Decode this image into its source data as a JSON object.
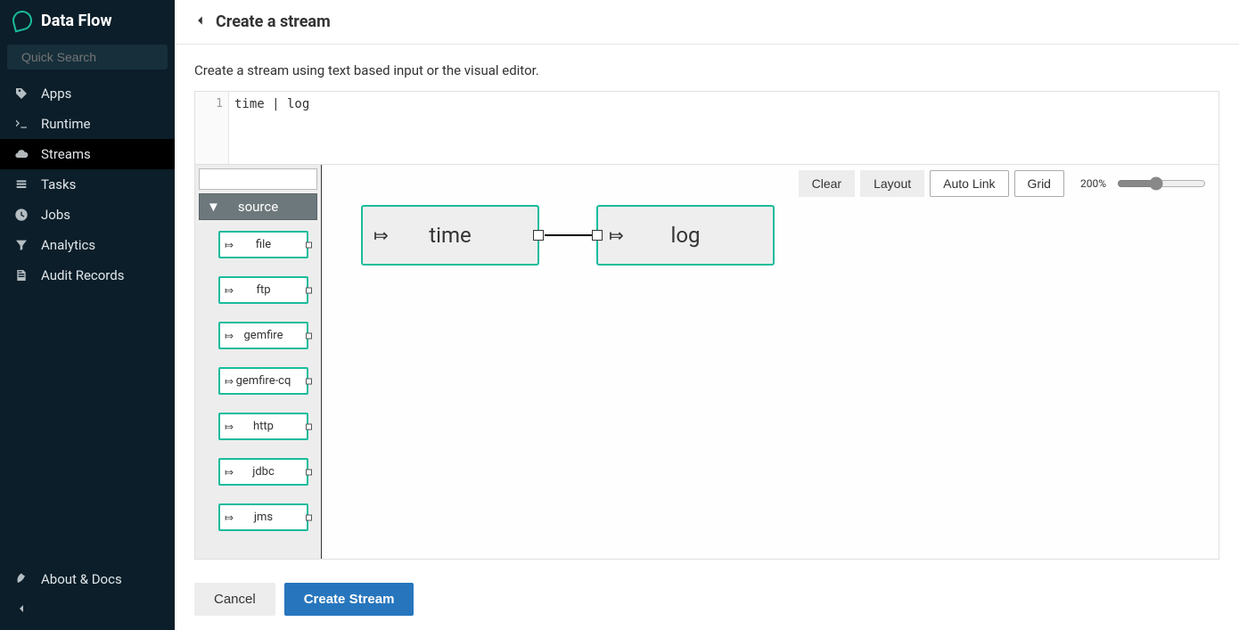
{
  "brand": {
    "title": "Data Flow"
  },
  "search": {
    "placeholder": "Quick Search"
  },
  "nav": {
    "items": [
      {
        "label": "Apps"
      },
      {
        "label": "Runtime"
      },
      {
        "label": "Streams",
        "active": true
      },
      {
        "label": "Tasks"
      },
      {
        "label": "Jobs"
      },
      {
        "label": "Analytics"
      },
      {
        "label": "Audit Records"
      }
    ],
    "bottom": [
      {
        "label": "About & Docs"
      }
    ]
  },
  "header": {
    "title": "Create a stream"
  },
  "description": "Create a stream using text based input or the visual editor.",
  "editor": {
    "line_no": "1",
    "code": "time | log"
  },
  "palette": {
    "header": "source",
    "items": [
      {
        "label": "file"
      },
      {
        "label": "ftp"
      },
      {
        "label": "gemfire"
      },
      {
        "label": "gemfire-cq"
      },
      {
        "label": "http"
      },
      {
        "label": "jdbc"
      },
      {
        "label": "jms"
      }
    ]
  },
  "toolbar": {
    "clear": "Clear",
    "layout": "Layout",
    "autolink": "Auto Link",
    "grid": "Grid",
    "zoom": "200%"
  },
  "canvas": {
    "nodes": [
      {
        "label": "time"
      },
      {
        "label": "log"
      }
    ]
  },
  "footer": {
    "cancel": "Cancel",
    "create": "Create Stream"
  }
}
